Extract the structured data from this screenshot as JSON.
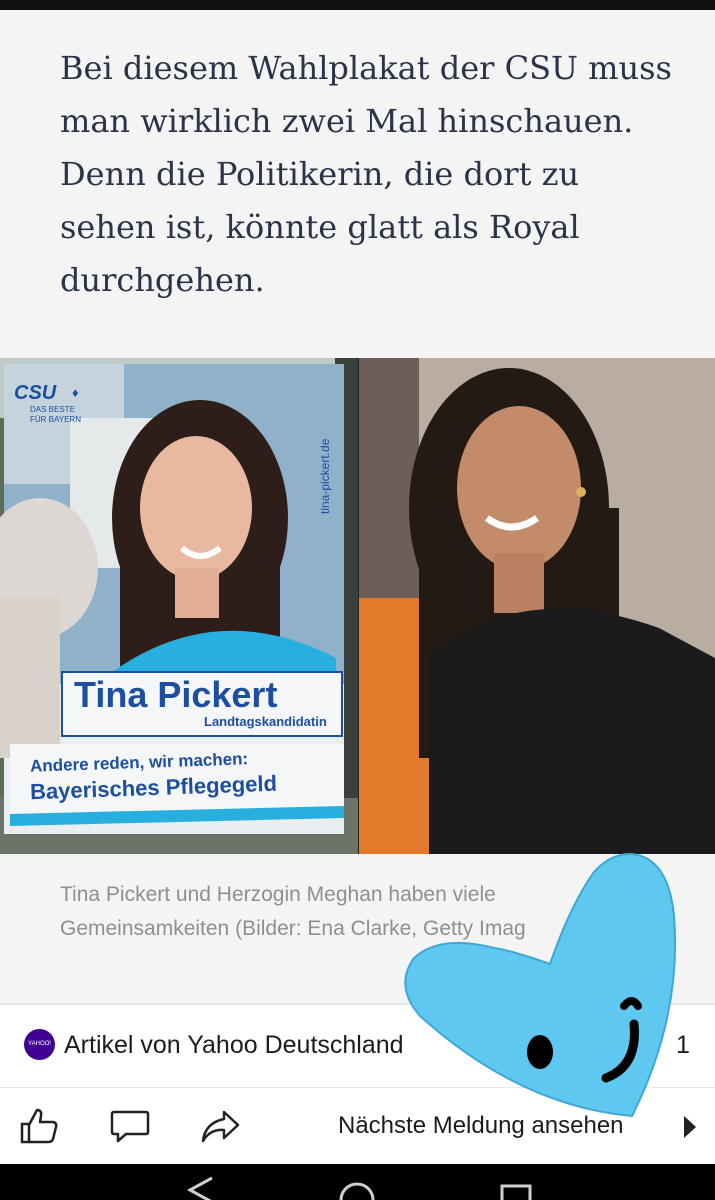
{
  "article": {
    "text": "Bei diesem Wahlplakat der CSU muss man wirklich zwei Mal hinschauen. Denn die Politikerin, die dort zu sehen ist, könnte glatt als Royal durchgehen."
  },
  "poster": {
    "party": "CSU",
    "slogan_small_1": "DAS BESTE",
    "slogan_small_2": "FÜR BAYERN",
    "url": "tina-pickert.de",
    "name": "Tina Pickert",
    "role": "Landtagskandidatin",
    "line1": "Andere reden, wir machen:",
    "line2": "Bayerisches Pflegegeld"
  },
  "caption": {
    "text": "Tina Pickert und Herzogin Meghan haben viele Gemeinsamkeiten (Bilder: Ena Clarke, Getty Imag"
  },
  "source": {
    "logo_text": "YAHOO!",
    "label": "Artikel von Yahoo Deutschland",
    "page_number": "1"
  },
  "actions": {
    "next_label": "Nächste Meldung ansehen"
  },
  "colors": {
    "accent_heart": "#5fc8f0",
    "text_dark": "#2a3347",
    "caption_gray": "#8f8f8f",
    "yahoo_purple": "#410093",
    "csu_blue": "#1c4fa0"
  }
}
